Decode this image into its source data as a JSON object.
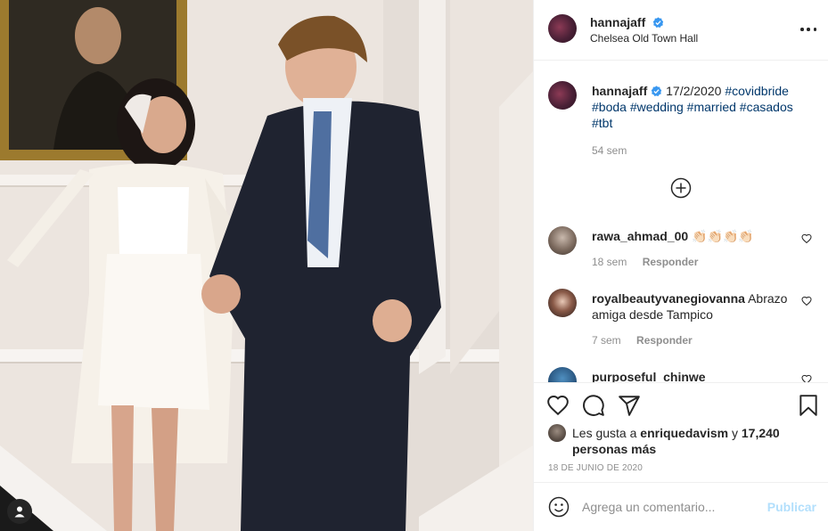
{
  "post": {
    "username": "hannajaff",
    "location": "Chelsea Old Town Hall",
    "verified": true
  },
  "caption": {
    "username": "hannajaff",
    "date_text": "17/2/2020",
    "hashtags": [
      "#covidbride",
      "#boda",
      "#wedding",
      "#married",
      "#casados",
      "#tbt"
    ],
    "age": "54 sem"
  },
  "comments": [
    {
      "username": "rawa_ahmad_00",
      "text": "👏🏻👏🏻👏🏻👏🏻",
      "age": "18 sem",
      "reply_label": "Responder"
    },
    {
      "username": "royalbeautyvanegiovanna",
      "text": "Abrazo amiga desde Tampico",
      "age": "7 sem",
      "reply_label": "Responder"
    },
    {
      "username": "purposeful_chinwe",
      "text": ""
    }
  ],
  "likes": {
    "prefix": "Les gusta a",
    "first_user": "enriquedavism",
    "conjunction": "y",
    "others": "17,240 personas más"
  },
  "post_date": "18 DE JUNIO DE 2020",
  "add_comment": {
    "placeholder": "Agrega un comentario...",
    "publish_label": "Publicar"
  },
  "icons": {
    "like": "heart-icon",
    "comment": "comment-icon",
    "share": "share-icon",
    "save": "bookmark-icon",
    "emoji": "emoji-icon",
    "more": "more-options-icon",
    "load_more": "plus-circle-icon",
    "tag": "user-tag-icon"
  },
  "colors": {
    "hashtag": "#00376b",
    "verified": "#3897f0",
    "publish_disabled": "#b2dffc",
    "secondary_text": "#8e8e8e"
  }
}
